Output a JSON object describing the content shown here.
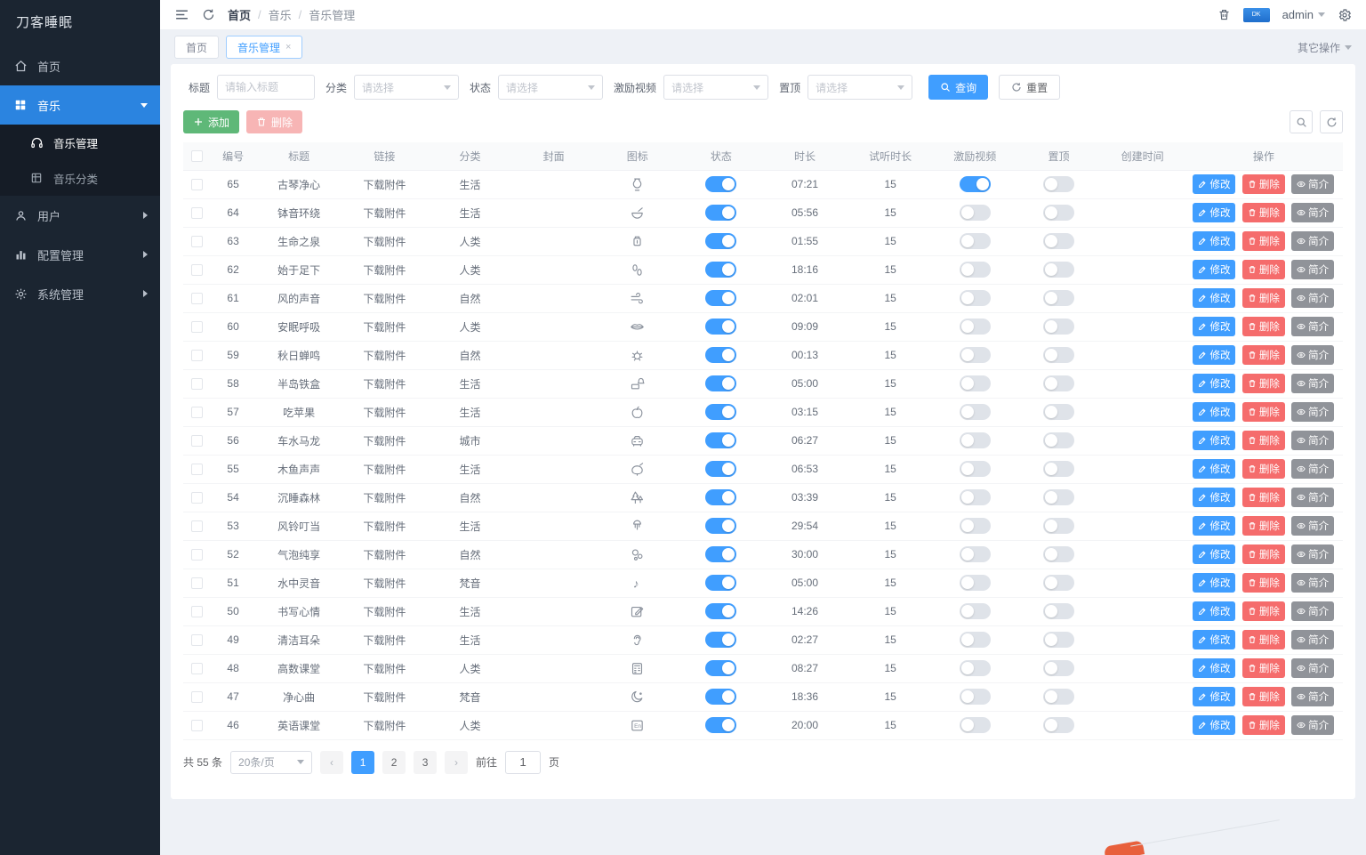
{
  "app": {
    "logo_text": "刀客睡眠",
    "accent_color": "#409eff",
    "sidebar_color": "#1b2531"
  },
  "sidebar": {
    "home": "首页",
    "music": "音乐",
    "music_manage": "音乐管理",
    "music_category": "音乐分类",
    "user": "用户",
    "config": "配置管理",
    "system": "系统管理"
  },
  "header": {
    "breadcrumb": [
      "首页",
      "音乐",
      "音乐管理"
    ],
    "sep": "/",
    "user": "admin"
  },
  "tabs": {
    "items": [
      {
        "label": "首页",
        "active": false
      },
      {
        "label": "音乐管理",
        "active": true,
        "close": "×"
      }
    ],
    "more": "其它操作"
  },
  "filters": {
    "title_label": "标题",
    "title_placeholder": "请输入标题",
    "category_label": "分类",
    "status_label": "状态",
    "reward_label": "激励视频",
    "top_label": "置顶",
    "select_placeholder": "请选择",
    "search_btn": "查询",
    "reset_btn": "重置"
  },
  "toolbar": {
    "add": "添加",
    "delete": "删除"
  },
  "table": {
    "columns": [
      "编号",
      "标题",
      "链接",
      "分类",
      "封面",
      "图标",
      "状态",
      "时长",
      "试听时长",
      "激励视频",
      "置顶",
      "创建时间",
      "操作"
    ],
    "actions": {
      "edit": "修改",
      "delete": "删除",
      "intro": "简介"
    },
    "rows": [
      {
        "id": 65,
        "title": "古琴净心",
        "link": "下载附件",
        "category": "生活",
        "icon": "guqin",
        "status": true,
        "duration": "07:21",
        "trial": "15",
        "reward": true,
        "top": false
      },
      {
        "id": 64,
        "title": "钵音环绕",
        "link": "下载附件",
        "category": "生活",
        "icon": "singing-bowl",
        "status": true,
        "duration": "05:56",
        "trial": "15",
        "reward": false,
        "top": false
      },
      {
        "id": 63,
        "title": "生命之泉",
        "link": "下载附件",
        "category": "人类",
        "icon": "water-spring",
        "status": true,
        "duration": "01:55",
        "trial": "15",
        "reward": false,
        "top": false
      },
      {
        "id": 62,
        "title": "始于足下",
        "link": "下载附件",
        "category": "人类",
        "icon": "footprints",
        "status": true,
        "duration": "18:16",
        "trial": "15",
        "reward": false,
        "top": false
      },
      {
        "id": 61,
        "title": "风的声音",
        "link": "下载附件",
        "category": "自然",
        "icon": "wind",
        "status": true,
        "duration": "02:01",
        "trial": "15",
        "reward": false,
        "top": false
      },
      {
        "id": 60,
        "title": "安眠呼吸",
        "link": "下载附件",
        "category": "人类",
        "icon": "lips",
        "status": true,
        "duration": "09:09",
        "trial": "15",
        "reward": false,
        "top": false
      },
      {
        "id": 59,
        "title": "秋日蝉鸣",
        "link": "下载附件",
        "category": "自然",
        "icon": "cicada",
        "status": true,
        "duration": "00:13",
        "trial": "15",
        "reward": false,
        "top": false
      },
      {
        "id": 58,
        "title": "半岛铁盒",
        "link": "下载附件",
        "category": "生活",
        "icon": "music-box",
        "status": true,
        "duration": "05:00",
        "trial": "15",
        "reward": false,
        "top": false
      },
      {
        "id": 57,
        "title": "吃苹果",
        "link": "下载附件",
        "category": "生活",
        "icon": "apple",
        "status": true,
        "duration": "03:15",
        "trial": "15",
        "reward": false,
        "top": false
      },
      {
        "id": 56,
        "title": "车水马龙",
        "link": "下载附件",
        "category": "城市",
        "icon": "car",
        "status": true,
        "duration": "06:27",
        "trial": "15",
        "reward": false,
        "top": false
      },
      {
        "id": 55,
        "title": "木鱼声声",
        "link": "下载附件",
        "category": "生活",
        "icon": "wooden-fish",
        "status": true,
        "duration": "06:53",
        "trial": "15",
        "reward": false,
        "top": false
      },
      {
        "id": 54,
        "title": "沉睡森林",
        "link": "下载附件",
        "category": "自然",
        "icon": "forest",
        "status": true,
        "duration": "03:39",
        "trial": "15",
        "reward": false,
        "top": false
      },
      {
        "id": 53,
        "title": "风铃叮当",
        "link": "下载附件",
        "category": "生活",
        "icon": "wind-chime",
        "status": true,
        "duration": "29:54",
        "trial": "15",
        "reward": false,
        "top": false
      },
      {
        "id": 52,
        "title": "气泡纯享",
        "link": "下载附件",
        "category": "自然",
        "icon": "bubbles",
        "status": true,
        "duration": "30:00",
        "trial": "15",
        "reward": false,
        "top": false
      },
      {
        "id": 51,
        "title": "水中灵音",
        "link": "下载附件",
        "category": "梵音",
        "icon": "treble-clef",
        "status": true,
        "duration": "05:00",
        "trial": "15",
        "reward": false,
        "top": false
      },
      {
        "id": 50,
        "title": "书写心情",
        "link": "下载附件",
        "category": "生活",
        "icon": "writing",
        "status": true,
        "duration": "14:26",
        "trial": "15",
        "reward": false,
        "top": false
      },
      {
        "id": 49,
        "title": "清洁耳朵",
        "link": "下载附件",
        "category": "生活",
        "icon": "ear",
        "status": true,
        "duration": "02:27",
        "trial": "15",
        "reward": false,
        "top": false
      },
      {
        "id": 48,
        "title": "高数课堂",
        "link": "下载附件",
        "category": "人类",
        "icon": "calculator",
        "status": true,
        "duration": "08:27",
        "trial": "15",
        "reward": false,
        "top": false
      },
      {
        "id": 47,
        "title": "净心曲",
        "link": "下载附件",
        "category": "梵音",
        "icon": "moon",
        "status": true,
        "duration": "18:36",
        "trial": "15",
        "reward": false,
        "top": false
      },
      {
        "id": 46,
        "title": "英语课堂",
        "link": "下载附件",
        "category": "人类",
        "icon": "english",
        "status": true,
        "duration": "20:00",
        "trial": "15",
        "reward": false,
        "top": false
      }
    ]
  },
  "pagination": {
    "total": "共 55 条",
    "page_size": "20条/页",
    "pages": [
      "1",
      "2",
      "3"
    ],
    "current": "1",
    "prev": "‹",
    "next": "›",
    "jump_prefix": "前往",
    "jump_value": "1",
    "jump_suffix": "页"
  }
}
